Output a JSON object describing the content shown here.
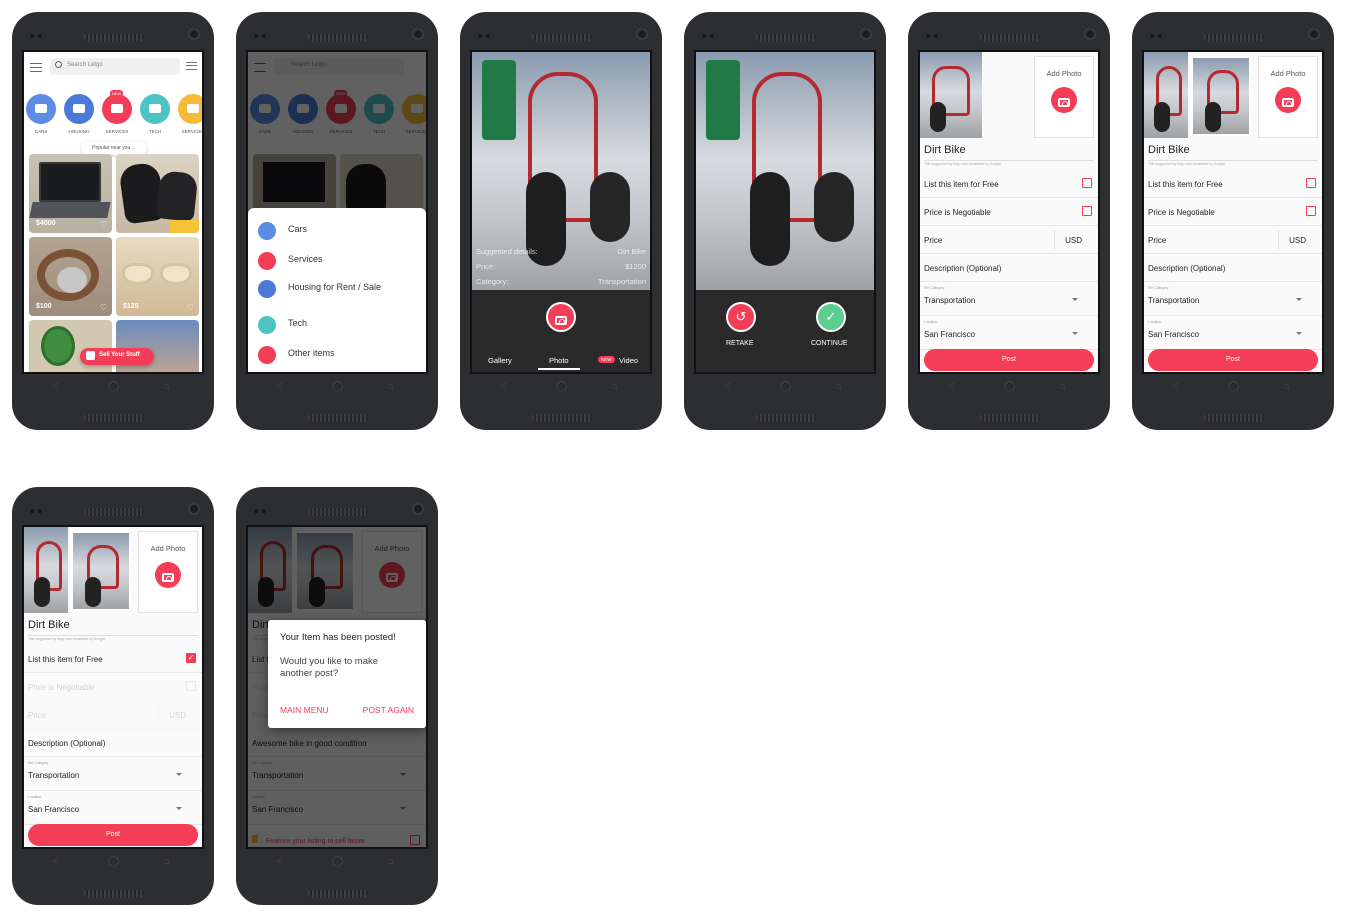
{
  "home": {
    "search_placeholder": "Search Letgo",
    "categories": [
      {
        "label": "CARS",
        "color": "#5b8de5"
      },
      {
        "label": "HOUSING",
        "color": "#4b79d8"
      },
      {
        "label": "SERVICES",
        "color": "#f43e58",
        "badge": "NEW"
      },
      {
        "label": "TECH",
        "color": "#4cc4c4"
      },
      {
        "label": "SERVICES",
        "color": "#f5bb38"
      }
    ],
    "popular_label": "Popular near you",
    "prices": [
      "$4000",
      "$100",
      "$125"
    ],
    "sell_button": "Sell Your Stuff"
  },
  "sheet": {
    "items": [
      {
        "label": "Cars",
        "color": "#5b8de5"
      },
      {
        "label": "Services",
        "color": "#f43e58"
      },
      {
        "label": "Housing for Rent / Sale",
        "color": "#4b79d8"
      },
      {
        "label": "Tech",
        "color": "#4cc4c4"
      },
      {
        "label": "Other items",
        "color": "#f43e58"
      }
    ]
  },
  "camera": {
    "suggested_label": "Suggested details:",
    "suggested_name": "Dirt Bike",
    "price_label": "Price:",
    "price_value": "$1200",
    "category_label": "Category:",
    "category_value": "Transportation",
    "tabs": [
      "Gallery",
      "Photo",
      "Video"
    ],
    "new_badge": "NEW",
    "retake": "RETAKE",
    "continue": "CONTINUE"
  },
  "form": {
    "add_photo": "Add Photo",
    "title": "Dirt Bike",
    "suggestion_note": "Title suggested by letgo and translated by Google",
    "free_label": "List this item for Free",
    "negotiable_label": "Price is Negotiable",
    "price_label": "Price",
    "currency": "USD",
    "description_placeholder": "Description (Optional)",
    "description_value": "Awesome bike in good condition",
    "category_caption": "Set Category",
    "category_value": "Transportation",
    "location_caption": "Location",
    "location_value": "San Francisco",
    "post_button": "Post",
    "feature_label": "Feature your listing to sell faster"
  },
  "dialog": {
    "title": "Your Item has been posted!",
    "message": "Would you like to make another post?",
    "main_menu": "MAIN MENU",
    "post_again": "POST AGAIN"
  },
  "colors": {
    "accent": "#f43e58",
    "confirm": "#5ccf8e",
    "phone": "#2d2e32"
  }
}
